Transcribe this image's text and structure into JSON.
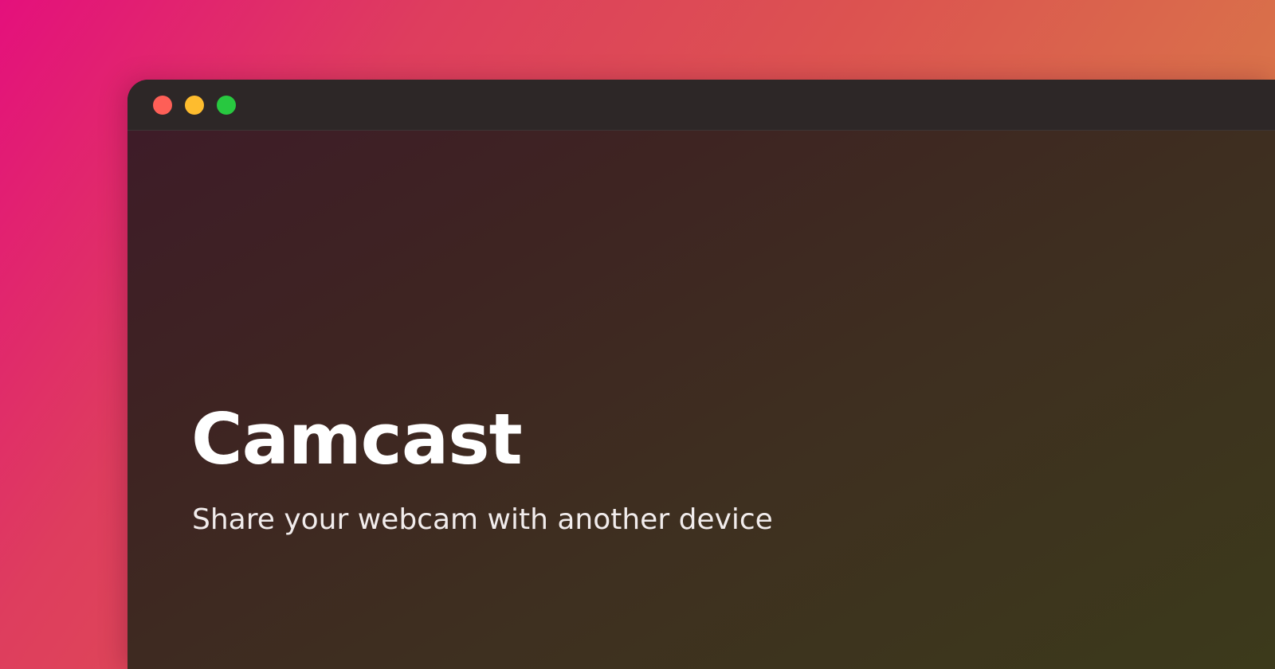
{
  "colors": {
    "traffic_close": "#fe5f57",
    "traffic_minimize": "#febc2e",
    "traffic_maximize": "#28c840"
  },
  "window": {
    "controls": [
      {
        "name": "close",
        "icon": "close-dot-icon"
      },
      {
        "name": "minimize",
        "icon": "minimize-dot-icon"
      },
      {
        "name": "maximize",
        "icon": "maximize-dot-icon"
      }
    ]
  },
  "hero": {
    "title": "Camcast",
    "subtitle": "Share your webcam with another device"
  }
}
